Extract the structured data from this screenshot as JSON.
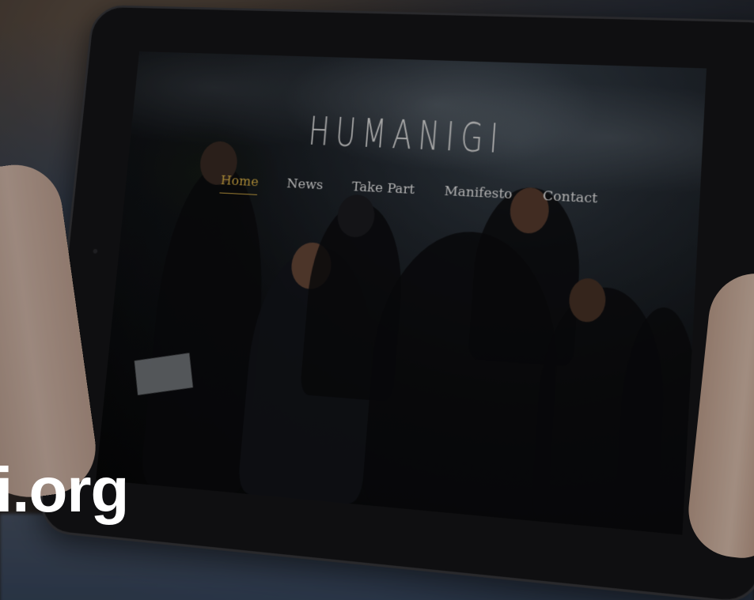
{
  "site": {
    "logo": "HUMANIGI",
    "nav": [
      {
        "label": "Home",
        "active": true
      },
      {
        "label": "News",
        "active": false
      },
      {
        "label": "Take Part",
        "active": false
      },
      {
        "label": "Manifesto",
        "active": false
      },
      {
        "label": "Contact",
        "active": false
      }
    ]
  },
  "overlay": {
    "domain_text": "i.org"
  },
  "colors": {
    "accent": "#e0b548",
    "nav_text": "#f0f0f0",
    "overlay_text": "#ffffff"
  }
}
